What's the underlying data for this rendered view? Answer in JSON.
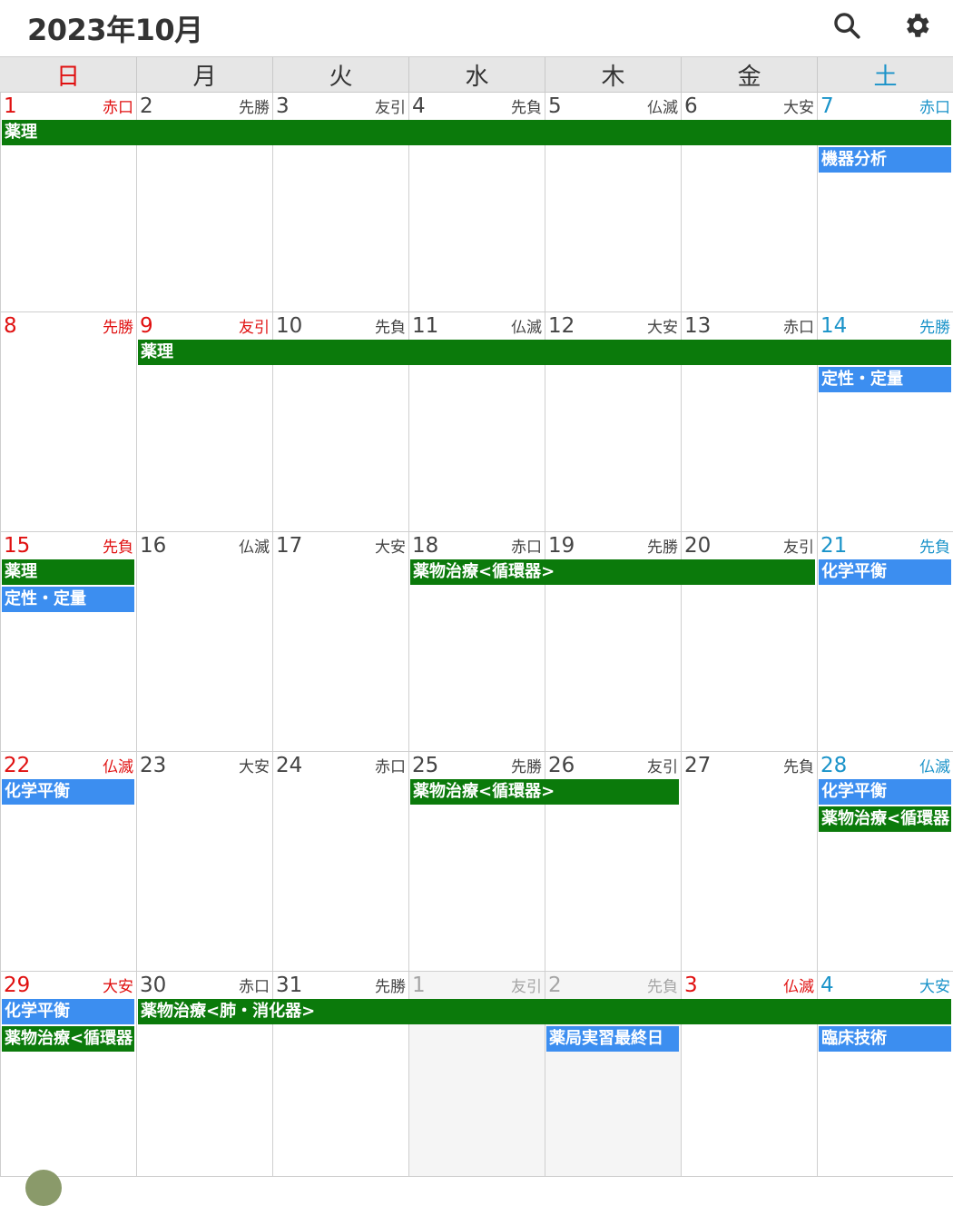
{
  "header": {
    "title": "2023年10月",
    "search_icon": "search-icon",
    "settings_icon": "gear-icon"
  },
  "weekdays": [
    "日",
    "月",
    "火",
    "水",
    "木",
    "金",
    "土"
  ],
  "colors": {
    "sunday": "#e01010",
    "saturday": "#1a93c9",
    "event_green": "#0b7a0b",
    "event_blue": "#3c8ef0"
  },
  "weeks": [
    [
      {
        "day": "1",
        "rokuyo": "赤口",
        "type": "sun"
      },
      {
        "day": "2",
        "rokuyo": "先勝",
        "type": ""
      },
      {
        "day": "3",
        "rokuyo": "友引",
        "type": ""
      },
      {
        "day": "4",
        "rokuyo": "先負",
        "type": ""
      },
      {
        "day": "5",
        "rokuyo": "仏滅",
        "type": ""
      },
      {
        "day": "6",
        "rokuyo": "大安",
        "type": ""
      },
      {
        "day": "7",
        "rokuyo": "赤口",
        "type": "sat"
      }
    ],
    [
      {
        "day": "8",
        "rokuyo": "先勝",
        "type": "sun"
      },
      {
        "day": "9",
        "rokuyo": "友引",
        "type": "hol"
      },
      {
        "day": "10",
        "rokuyo": "先負",
        "type": ""
      },
      {
        "day": "11",
        "rokuyo": "仏滅",
        "type": ""
      },
      {
        "day": "12",
        "rokuyo": "大安",
        "type": ""
      },
      {
        "day": "13",
        "rokuyo": "赤口",
        "type": ""
      },
      {
        "day": "14",
        "rokuyo": "先勝",
        "type": "sat"
      }
    ],
    [
      {
        "day": "15",
        "rokuyo": "先負",
        "type": "sun"
      },
      {
        "day": "16",
        "rokuyo": "仏滅",
        "type": ""
      },
      {
        "day": "17",
        "rokuyo": "大安",
        "type": ""
      },
      {
        "day": "18",
        "rokuyo": "赤口",
        "type": ""
      },
      {
        "day": "19",
        "rokuyo": "先勝",
        "type": ""
      },
      {
        "day": "20",
        "rokuyo": "友引",
        "type": ""
      },
      {
        "day": "21",
        "rokuyo": "先負",
        "type": "sat"
      }
    ],
    [
      {
        "day": "22",
        "rokuyo": "仏滅",
        "type": "sun"
      },
      {
        "day": "23",
        "rokuyo": "大安",
        "type": ""
      },
      {
        "day": "24",
        "rokuyo": "赤口",
        "type": ""
      },
      {
        "day": "25",
        "rokuyo": "先勝",
        "type": ""
      },
      {
        "day": "26",
        "rokuyo": "友引",
        "type": ""
      },
      {
        "day": "27",
        "rokuyo": "先負",
        "type": ""
      },
      {
        "day": "28",
        "rokuyo": "仏滅",
        "type": "sat"
      }
    ],
    [
      {
        "day": "29",
        "rokuyo": "大安",
        "type": "sun"
      },
      {
        "day": "30",
        "rokuyo": "赤口",
        "type": ""
      },
      {
        "day": "31",
        "rokuyo": "先勝",
        "type": ""
      },
      {
        "day": "1",
        "rokuyo": "友引",
        "type": "out"
      },
      {
        "day": "2",
        "rokuyo": "先負",
        "type": "out"
      },
      {
        "day": "3",
        "rokuyo": "仏滅",
        "type": "hol"
      },
      {
        "day": "4",
        "rokuyo": "大安",
        "type": "sat"
      }
    ]
  ],
  "events": [
    {
      "week": 0,
      "startCol": 0,
      "span": 7,
      "row": 0,
      "label": "薬理",
      "color": "green"
    },
    {
      "week": 0,
      "startCol": 6,
      "span": 1,
      "row": 1,
      "label": "機器分析",
      "color": "blue"
    },
    {
      "week": 1,
      "startCol": 1,
      "span": 6,
      "row": 0,
      "label": "薬理",
      "color": "green"
    },
    {
      "week": 1,
      "startCol": 6,
      "span": 1,
      "row": 1,
      "label": "定性・定量",
      "color": "blue"
    },
    {
      "week": 2,
      "startCol": 0,
      "span": 1,
      "row": 0,
      "label": "薬理",
      "color": "green"
    },
    {
      "week": 2,
      "startCol": 0,
      "span": 1,
      "row": 1,
      "label": "定性・定量",
      "color": "blue"
    },
    {
      "week": 2,
      "startCol": 3,
      "span": 3,
      "row": 0,
      "label": "薬物治療<循環器>",
      "color": "green"
    },
    {
      "week": 2,
      "startCol": 6,
      "span": 1,
      "row": 0,
      "label": "化学平衡",
      "color": "blue"
    },
    {
      "week": 3,
      "startCol": 0,
      "span": 1,
      "row": 0,
      "label": "化学平衡",
      "color": "blue"
    },
    {
      "week": 3,
      "startCol": 3,
      "span": 2,
      "row": 0,
      "label": "薬物治療<循環器>",
      "color": "green"
    },
    {
      "week": 3,
      "startCol": 6,
      "span": 1,
      "row": 0,
      "label": "化学平衡",
      "color": "blue"
    },
    {
      "week": 3,
      "startCol": 6,
      "span": 1,
      "row": 1,
      "label": "薬物治療<循環器>",
      "color": "green"
    },
    {
      "week": 4,
      "startCol": 0,
      "span": 1,
      "row": 0,
      "label": "化学平衡",
      "color": "blue"
    },
    {
      "week": 4,
      "startCol": 0,
      "span": 1,
      "row": 1,
      "label": "薬物治療<循環器>",
      "color": "green"
    },
    {
      "week": 4,
      "startCol": 1,
      "span": 6,
      "row": 0,
      "label": "薬物治療<肺・消化器>",
      "color": "green"
    },
    {
      "week": 4,
      "startCol": 4,
      "span": 1,
      "row": 1,
      "label": "薬局実習最終日",
      "color": "blue"
    },
    {
      "week": 4,
      "startCol": 6,
      "span": 1,
      "row": 1,
      "label": "臨床技術",
      "color": "blue"
    }
  ]
}
